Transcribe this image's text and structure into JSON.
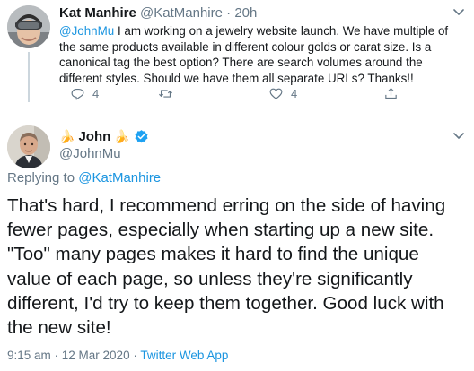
{
  "parent_tweet": {
    "name": "Kat Manhire",
    "handle": "@KatManhire",
    "separator": "·",
    "time": "20h",
    "mention": "@JohnMu",
    "text": " I am working on a jewelry website launch. We have multiple of the same products available in different colour golds or carat size. Is a canonical tag the best option? There are search volumes around the different styles. Should we have them all separate URLs? Thanks!!",
    "reply_count": "4",
    "like_count": "4"
  },
  "reply_tweet": {
    "name_prefix_emoji": "🍌",
    "name": "John",
    "name_suffix_emoji": "🍌",
    "handle": "@JohnMu",
    "replying_to_label": "Replying to",
    "replying_to_handle": "@KatManhire",
    "text": "That's hard, I recommend erring on the side of having\nfewer pages, especially when starting up a new site.\n\"Too\" many pages makes it hard to find the unique\nvalue of each  page, so unless they're significantly\ndifferent, I'd try to keep them together. Good luck with\nthe new site!",
    "timestamp": "9:15 am · 12 Mar 2020 · ",
    "source": "Twitter Web App"
  },
  "colors": {
    "link_blue": "#1b95e0",
    "muted_gray": "#657786",
    "text_dark": "#14171a",
    "thread_line": "#ccd6dd",
    "verified_blue": "#1da1f2"
  },
  "icons": [
    "chevron-down-icon",
    "reply-icon",
    "retweet-icon",
    "like-icon",
    "share-icon",
    "verified-badge-icon"
  ]
}
